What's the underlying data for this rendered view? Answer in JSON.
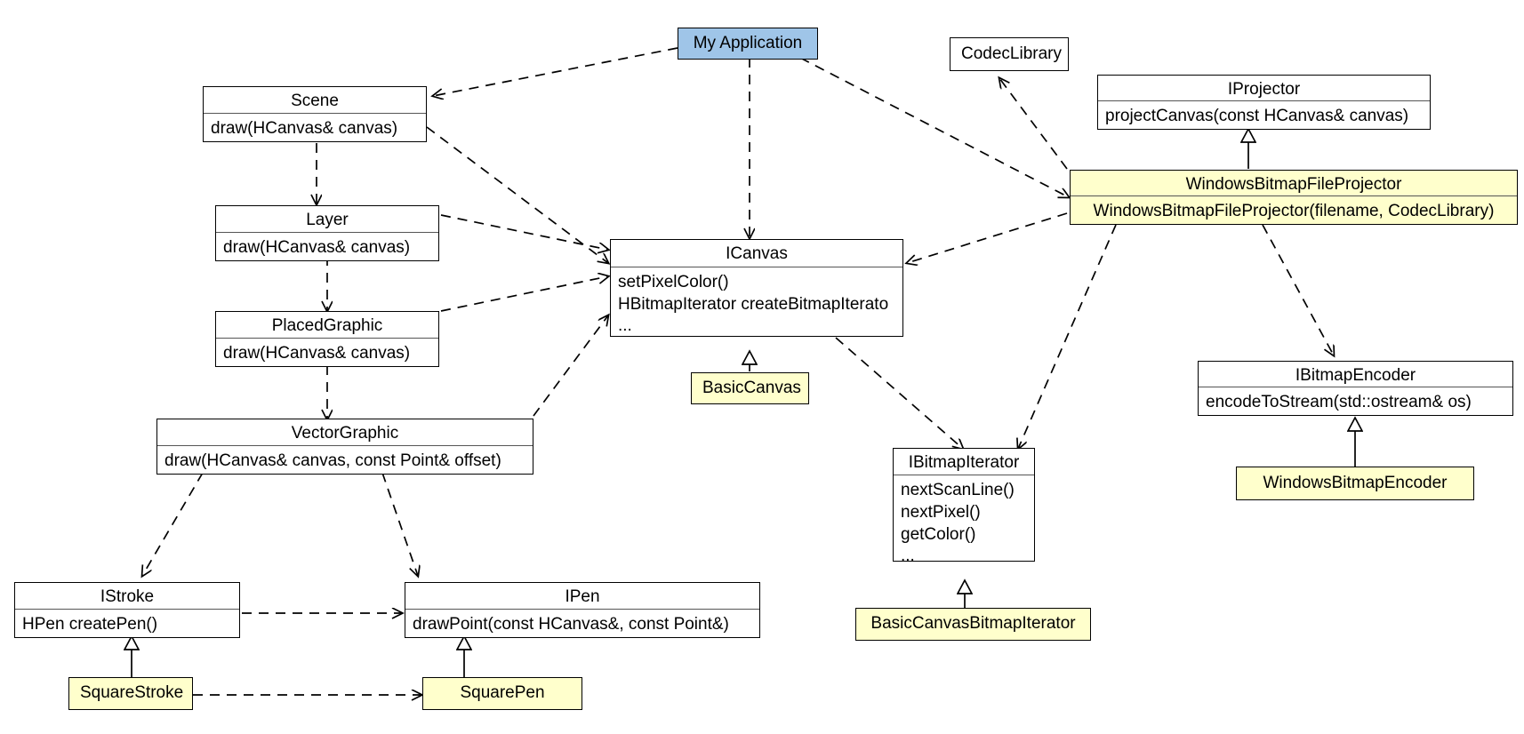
{
  "diagram": {
    "title": "Canvas / Projector UML class diagram",
    "colors": {
      "plain_fill": "#ffffff",
      "highlight_fill": "#ffffcc",
      "application_fill": "#9fc5e8",
      "border": "#000000",
      "edge": "#000000"
    }
  },
  "nodes": {
    "my_application": {
      "name": "My Application",
      "style": "blue",
      "methods": []
    },
    "scene": {
      "name": "Scene",
      "style": "plain",
      "methods": [
        "draw(HCanvas& canvas)"
      ]
    },
    "layer": {
      "name": "Layer",
      "style": "plain",
      "methods": [
        "draw(HCanvas& canvas)"
      ]
    },
    "placed_graphic": {
      "name": "PlacedGraphic",
      "style": "plain",
      "methods": [
        "draw(HCanvas& canvas)"
      ]
    },
    "vector_graphic": {
      "name": "VectorGraphic",
      "style": "plain",
      "methods": [
        "draw(HCanvas& canvas, const Point& offset)"
      ]
    },
    "icanvas": {
      "name": "ICanvas",
      "style": "plain",
      "methods": [
        "setPixelColor()",
        "HBitmapIterator createBitmapIterato",
        "..."
      ]
    },
    "basic_canvas": {
      "name": "BasicCanvas",
      "style": "yellow",
      "methods": []
    },
    "istroke": {
      "name": "IStroke",
      "style": "plain",
      "methods": [
        "HPen createPen()"
      ]
    },
    "square_stroke": {
      "name": "SquareStroke",
      "style": "yellow",
      "methods": []
    },
    "ipen": {
      "name": "IPen",
      "style": "plain",
      "methods": [
        "drawPoint(const HCanvas&, const Point&)"
      ]
    },
    "square_pen": {
      "name": "SquarePen",
      "style": "yellow",
      "methods": []
    },
    "ibitmap_iterator": {
      "name": "IBitmapIterator",
      "style": "plain",
      "methods": [
        "nextScanLine()",
        "nextPixel()",
        "getColor()",
        "..."
      ]
    },
    "basic_canvas_bitmap_iterator": {
      "name": "BasicCanvasBitmapIterator",
      "style": "yellow",
      "methods": []
    },
    "codec_library": {
      "name": "CodecLibrary",
      "style": "plain",
      "methods": []
    },
    "iprojector": {
      "name": "IProjector",
      "style": "plain",
      "methods": [
        "projectCanvas(const HCanvas& canvas)"
      ]
    },
    "windows_bitmap_file_projector": {
      "name": "WindowsBitmapFileProjector",
      "style": "yellow",
      "methods": [
        "WindowsBitmapFileProjector(filename, CodecLibrary)"
      ]
    },
    "ibitmap_encoder": {
      "name": "IBitmapEncoder",
      "style": "plain",
      "methods": [
        "encodeToStream(std::ostream& os)"
      ]
    },
    "windows_bitmap_encoder": {
      "name": "WindowsBitmapEncoder",
      "style": "yellow",
      "methods": []
    }
  },
  "edges": [
    {
      "from": "my_application",
      "to": "scene",
      "kind": "dependency"
    },
    {
      "from": "my_application",
      "to": "icanvas",
      "kind": "dependency"
    },
    {
      "from": "my_application",
      "to": "windows_bitmap_file_projector",
      "kind": "dependency"
    },
    {
      "from": "scene",
      "to": "layer",
      "kind": "dependency"
    },
    {
      "from": "scene",
      "to": "icanvas",
      "kind": "dependency"
    },
    {
      "from": "layer",
      "to": "placed_graphic",
      "kind": "dependency"
    },
    {
      "from": "layer",
      "to": "icanvas",
      "kind": "dependency"
    },
    {
      "from": "placed_graphic",
      "to": "vector_graphic",
      "kind": "dependency"
    },
    {
      "from": "placed_graphic",
      "to": "icanvas",
      "kind": "dependency"
    },
    {
      "from": "vector_graphic",
      "to": "icanvas",
      "kind": "dependency"
    },
    {
      "from": "vector_graphic",
      "to": "istroke",
      "kind": "dependency"
    },
    {
      "from": "vector_graphic",
      "to": "ipen",
      "kind": "dependency"
    },
    {
      "from": "istroke",
      "to": "ipen",
      "kind": "dependency"
    },
    {
      "from": "square_stroke",
      "to": "istroke",
      "kind": "generalization"
    },
    {
      "from": "square_stroke",
      "to": "square_pen",
      "kind": "dependency"
    },
    {
      "from": "square_pen",
      "to": "ipen",
      "kind": "generalization"
    },
    {
      "from": "basic_canvas",
      "to": "icanvas",
      "kind": "generalization"
    },
    {
      "from": "icanvas",
      "to": "ibitmap_iterator",
      "kind": "dependency"
    },
    {
      "from": "basic_canvas_bitmap_iterator",
      "to": "ibitmap_iterator",
      "kind": "generalization"
    },
    {
      "from": "windows_bitmap_file_projector",
      "to": "iprojector",
      "kind": "generalization"
    },
    {
      "from": "windows_bitmap_file_projector",
      "to": "codec_library",
      "kind": "dependency"
    },
    {
      "from": "windows_bitmap_file_projector",
      "to": "icanvas",
      "kind": "dependency"
    },
    {
      "from": "windows_bitmap_file_projector",
      "to": "ibitmap_iterator",
      "kind": "dependency"
    },
    {
      "from": "windows_bitmap_file_projector",
      "to": "ibitmap_encoder",
      "kind": "dependency"
    },
    {
      "from": "windows_bitmap_encoder",
      "to": "ibitmap_encoder",
      "kind": "generalization"
    }
  ]
}
